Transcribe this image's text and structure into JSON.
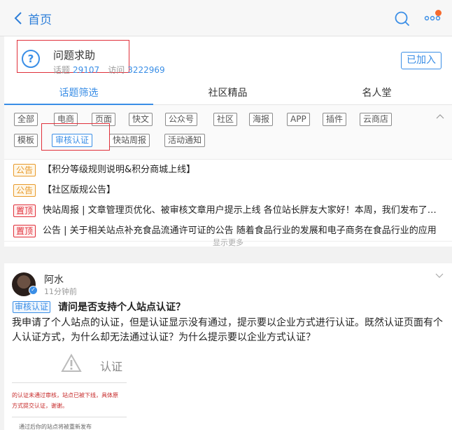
{
  "header": {
    "back_label": "首页"
  },
  "topic": {
    "title": "问题求助",
    "topics_label": "话题",
    "topics_count": "29107",
    "visits_label": "访问",
    "visits_count": "3222969",
    "join_label": "已加入"
  },
  "tabs": [
    "话题筛选",
    "社区精品",
    "名人堂"
  ],
  "filters": {
    "row1": [
      "全部",
      "电商",
      "页面",
      "快文",
      "公众号",
      "社区",
      "海报",
      "APP",
      "插件",
      "云商店"
    ],
    "row2": [
      "模板",
      "审核认证",
      "快站周报",
      "活动通知"
    ],
    "active": "审核认证"
  },
  "notices": [
    {
      "badge": "公告",
      "text": "【积分等级规则说明&积分商城上线】"
    },
    {
      "badge": "公告",
      "text": "【社区版规公告】"
    },
    {
      "badge": "置顶",
      "text": "快站周报 | 文章管理页优化、被审核文章用户提示上线 各位站长胖友大家好！本周，我们发布了以下功能更新"
    },
    {
      "badge": "置顶",
      "text": "公告 | 关于相关站点补充食品流通许可证的公告 随着食品行业的发展和电子商务在食品行业的应用"
    }
  ],
  "show_more": "显示更多",
  "post": {
    "author": "阿水",
    "time": "11分钟前",
    "tag": "审核认证",
    "title": "请问是否支持个人站点认证？",
    "body": "我申请了个人站点的认证，但是认证显示没有通过，提示要以企业方式进行认证。既然认证页面有个人认证方式，为什么却无法通过认证？为什么提示要以企业方式认证？",
    "image": {
      "caption": "认证",
      "line1": "的认证未通过审核，站点已被下线，具体原",
      "line2": "方式提交认证，谢谢。",
      "line3": "通过后你的站点将被重新发布"
    }
  },
  "colors": {
    "accent": "#3a8ee6",
    "highlight_box": "#e0303a",
    "notice": "#e89a2b",
    "pinned": "#e0303a"
  }
}
